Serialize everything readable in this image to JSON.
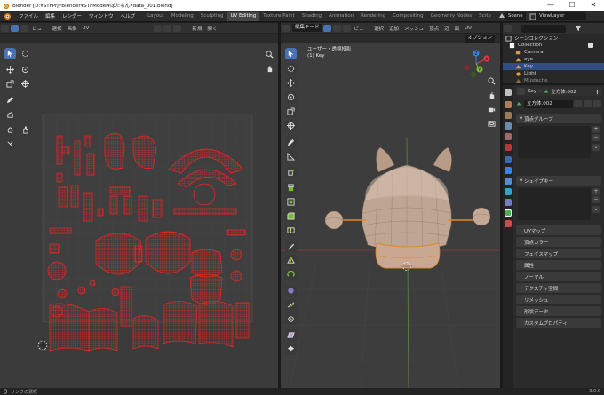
{
  "window": {
    "title": "Blender [D:¥STFPrj¥Blender¥STFModel¥ぼたもん¥data_001.blend]",
    "controls": [
      "—",
      "☐",
      "✕"
    ]
  },
  "menu": {
    "items": [
      "ファイル",
      "編集",
      "レンダー",
      "ウィンドウ",
      "ヘルプ"
    ],
    "workspaces": [
      "Layout",
      "Modeling",
      "Sculpting",
      "UV Editing",
      "Texture Paint",
      "Shading",
      "Animation",
      "Rendering",
      "Compositing",
      "Geometry Nodes",
      "Scrip"
    ],
    "active_workspace": "UV Editing",
    "scene": "Scene",
    "view_layer": "ViewLayer"
  },
  "uv_editor": {
    "header": {
      "view": "ビュー",
      "select": "選択",
      "image": "画像",
      "uv": "UV",
      "new": "新規",
      "open": "開く"
    }
  },
  "viewport": {
    "mode": "編集モード",
    "menu": [
      "ビュー",
      "選択",
      "追加",
      "メッシュ",
      "頂点",
      "辺",
      "面",
      "UV"
    ],
    "options": "オプション",
    "view_name": "ユーザー・透視投影",
    "object_label": "(1) Key",
    "gizmo": {
      "x": "X",
      "y": "Y",
      "z": "Z"
    }
  },
  "outliner": {
    "header": "シーンコレクション",
    "items": [
      {
        "label": "Collection",
        "indent": 1
      },
      {
        "label": "Camera",
        "indent": 2
      },
      {
        "label": "eye",
        "indent": 2
      },
      {
        "label": "Key",
        "indent": 2
      },
      {
        "label": "Light",
        "indent": 2
      },
      {
        "label": "Mustache",
        "indent": 2
      }
    ],
    "selected": "Key"
  },
  "properties": {
    "breadcrumb": {
      "object": "Key",
      "mesh": "立方体.002"
    },
    "mesh_field": "立方体.002",
    "panels": {
      "vertex_groups": "頂点グループ",
      "shape_keys": "シェイプキー",
      "uv_maps": "UVマップ",
      "vertex_colors": "頂点カラー",
      "face_maps": "フェイスマップ",
      "attributes": "属性",
      "normals": "ノーマル",
      "texture_space": "テクスチャ空間",
      "remesh": "リメッシュ",
      "shape_data": "形状データ",
      "custom_props": "カスタムプロパティ"
    }
  },
  "status": {
    "left": "リンクの選択",
    "version": "3.0.0"
  },
  "colors": {
    "accent": "#4772b3",
    "uv_wire": "#ff1a1a",
    "selection": "#334d80",
    "mesh": "#c8a48a",
    "x_axis": "#e0384d",
    "y_axis": "#7bb93a",
    "z_axis": "#3b82e0"
  }
}
